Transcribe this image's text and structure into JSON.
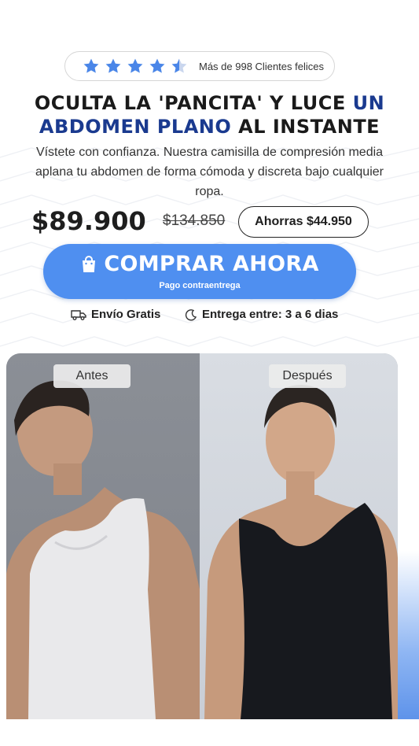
{
  "rating": {
    "stars_filled": 4.5,
    "stars_total": 5,
    "star_color": "#4a86e8",
    "text": "Más de 998 Clientes felices"
  },
  "headline": {
    "part1": "OCULTA LA 'PANCITA' Y LUCE ",
    "part2_blue": "UN",
    "part3_blue": "ABDOMEN PLANO",
    "part4": " AL INSTANTE"
  },
  "subtext": "Vístete con confianza. Nuestra camisilla de compresión media aplana tu abdomen de forma cómoda y discreta bajo cualquier ropa.",
  "pricing": {
    "current": "$89.900",
    "original": "$134.850",
    "savings": "Ahorras $44.950"
  },
  "cta": {
    "label": "COMPRAR AHORA",
    "sublabel": "Pago contraentrega",
    "icon": "shopping-bag-icon",
    "color": "#4f8ff0"
  },
  "features": [
    {
      "icon": "truck-icon",
      "label": "Envío Gratis"
    },
    {
      "icon": "moon-clock-icon",
      "label": "Entrega entre: 3 a 6 dias"
    }
  ],
  "comparison": {
    "before_label": "Antes",
    "after_label": "Después"
  },
  "colors": {
    "headline_blue": "#1a3a8f",
    "text_dark": "#1e1e1e"
  }
}
